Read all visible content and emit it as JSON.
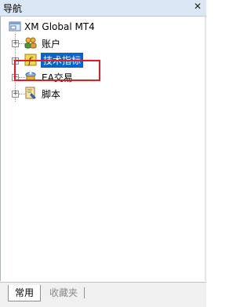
{
  "window": {
    "title": "导航"
  },
  "tree": {
    "root": {
      "label": "XM Global MT4",
      "icon": "server-icon"
    },
    "items": [
      {
        "label": "账户",
        "icon": "accounts-icon"
      },
      {
        "label": "技术指标",
        "icon": "indicator-icon",
        "selected": true
      },
      {
        "label": "EA交易",
        "icon": "expert-advisor-icon"
      },
      {
        "label": "脚本",
        "icon": "script-icon"
      }
    ]
  },
  "tabs": [
    {
      "label": "常用",
      "active": true
    },
    {
      "label": "收藏夹",
      "active": false
    }
  ],
  "colors": {
    "selection": "#0a64c8",
    "highlight_box": "#e01b2a",
    "titlebar": "#dce7f5"
  }
}
